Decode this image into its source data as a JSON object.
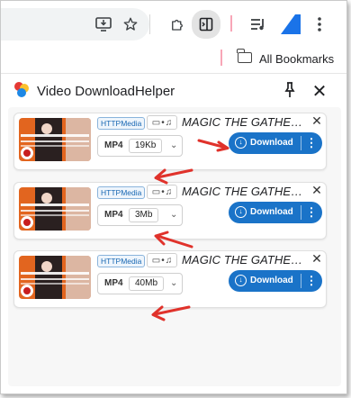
{
  "toolbar": {
    "icons": [
      "install-app-icon",
      "star-icon",
      "extensions-icon",
      "side-panel-icon",
      "reading-list-icon",
      "profile-icon",
      "menu-icon"
    ]
  },
  "bookmarks": {
    "label": "All Bookmarks"
  },
  "panel": {
    "title": "Video DownloadHelper"
  },
  "items": [
    {
      "badge": "HTTPMedia",
      "title": "MAGIC THE GATHERIN...",
      "format": "MP4",
      "size": "19Kb",
      "download_label": "Download"
    },
    {
      "badge": "HTTPMedia",
      "title": "MAGIC THE GATHERIN...",
      "format": "MP4",
      "size": "3Mb",
      "download_label": "Download"
    },
    {
      "badge": "HTTPMedia",
      "title": "MAGIC THE GATHERIN...",
      "format": "MP4",
      "size": "40Mb",
      "download_label": "Download"
    }
  ],
  "colors": {
    "accent": "#1a73c8",
    "annotation_arrow": "#e0322b"
  }
}
